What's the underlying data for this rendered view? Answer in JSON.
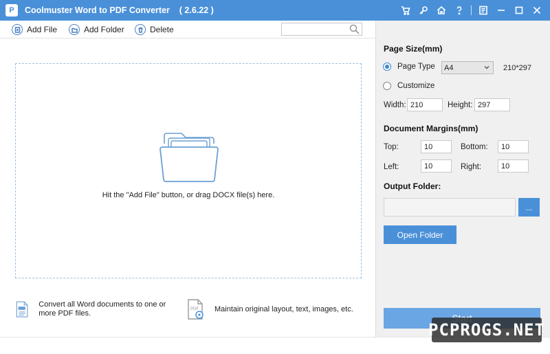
{
  "app": {
    "logo_text": "P",
    "title": "Coolmuster Word to PDF Converter    ( 2.6.22 )"
  },
  "titlebar_icons": [
    "cart-icon",
    "key-icon",
    "home-icon",
    "help-icon",
    "feedback-icon",
    "minimize-icon",
    "maximize-icon",
    "close-icon"
  ],
  "toolbar": {
    "add_file": "Add File",
    "add_folder": "Add Folder",
    "delete": "Delete",
    "search_placeholder": ""
  },
  "dropzone": {
    "hint": "Hit the \"Add File\" button, or drag DOCX file(s) here."
  },
  "features": [
    {
      "icon": "word-doc-icon",
      "text": "Convert all Word documents to one or more PDF files."
    },
    {
      "icon": "pdf-settings-icon",
      "text": "Maintain original layout, text, images, etc."
    }
  ],
  "settings": {
    "page_size_title": "Page Size(mm)",
    "page_type_label": "Page Type",
    "page_type_value": "A4",
    "page_type_dims": "210*297",
    "customize_label": "Customize",
    "width_label": "Width:",
    "width_value": "210",
    "height_label": "Height:",
    "height_value": "297",
    "margins_title": "Document Margins(mm)",
    "top_label": "Top:",
    "top_value": "10",
    "bottom_label": "Bottom:",
    "bottom_value": "10",
    "left_label": "Left:",
    "left_value": "10",
    "right_label": "Right:",
    "right_value": "10",
    "output_title": "Output Folder:",
    "output_path": "",
    "browse_label": "...",
    "open_folder_label": "Open Folder",
    "start_label": "Start"
  },
  "watermark": "PCPROGS.NET",
  "colors": {
    "accent": "#4a90d9",
    "panel": "#f0f0f0",
    "dash": "#9ebfdf"
  }
}
